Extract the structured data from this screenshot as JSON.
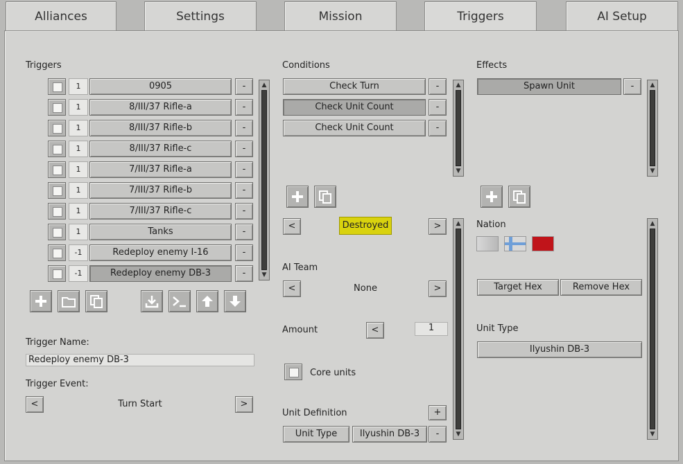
{
  "tabs": [
    {
      "label": "Alliances"
    },
    {
      "label": "Settings"
    },
    {
      "label": "Mission"
    },
    {
      "label": "Triggers"
    },
    {
      "label": "AI Setup"
    }
  ],
  "triggers": {
    "heading": "Triggers",
    "rows": [
      {
        "count": "1",
        "name": "0905"
      },
      {
        "count": "1",
        "name": "8/III/37 Rifle-a"
      },
      {
        "count": "1",
        "name": "8/III/37 Rifle-b"
      },
      {
        "count": "1",
        "name": "8/III/37 Rifle-c"
      },
      {
        "count": "1",
        "name": "7/III/37 Rifle-a"
      },
      {
        "count": "1",
        "name": "7/III/37 Rifle-b"
      },
      {
        "count": "1",
        "name": "7/III/37 Rifle-c"
      },
      {
        "count": "1",
        "name": "Tanks"
      },
      {
        "count": "-1",
        "name": "Redeploy enemy I-16"
      },
      {
        "count": "-1",
        "name": "Redeploy enemy DB-3"
      }
    ],
    "remove_label": "-",
    "name_label": "Trigger Name:",
    "name_value": "Redeploy enemy DB-3",
    "event_label": "Trigger Event:",
    "event_value": "Turn Start",
    "prev": "<",
    "next": ">"
  },
  "conditions": {
    "heading": "Conditions",
    "items": [
      "Check Turn",
      "Check Unit Count",
      "Check Unit Count"
    ],
    "remove_label": "-",
    "state_value": "Destroyed",
    "ai_team_label": "AI Team",
    "ai_team_value": "None",
    "amount_label": "Amount",
    "amount_value": "1",
    "core_units_label": "Core units",
    "unit_def_label": "Unit Definition",
    "add_label": "+",
    "unit_type_btn": "Unit Type",
    "unit_type_value": "Ilyushin DB-3",
    "prev": "<",
    "next": ">"
  },
  "effects": {
    "heading": "Effects",
    "items": [
      "Spawn Unit"
    ],
    "remove_label": "-",
    "nation_label": "Nation",
    "target_hex": "Target Hex",
    "remove_hex": "Remove Hex",
    "unit_type_label": "Unit Type",
    "unit_type_value": "Ilyushin DB-3"
  },
  "colors": {
    "highlight": "#d9d20e",
    "flag_red": "#c0141a"
  }
}
